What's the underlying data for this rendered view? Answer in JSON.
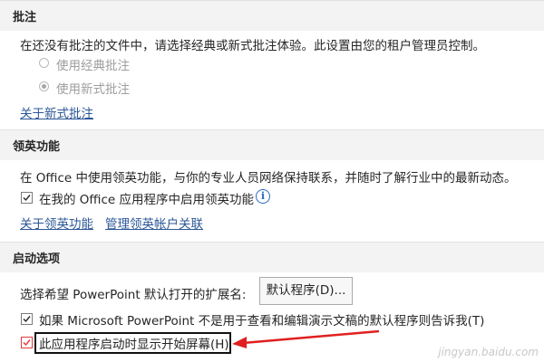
{
  "annotations": {
    "sec1": {
      "title": "批注",
      "desc": "在还没有批注的文件中，请选择经典或新式批注体验。此设置由您的租户管理员控制。",
      "opt_classic": "使用经典批注",
      "opt_modern": "使用新式批注",
      "selected": "opt_modern",
      "link": "关于新式批注"
    },
    "sec2": {
      "title": "领英功能",
      "desc": "在 Office 中使用领英功能，与你的专业人员网络保持联系，并随时了解行业中的最新动态。",
      "enable_label": "在我的 Office 应用程序中启用领英功能",
      "enable_checked": true,
      "link_about": "关于领英功能",
      "link_manage": "管理领英帐户关联"
    },
    "sec3": {
      "title": "启动选项",
      "ext_label": "选择希望 PowerPoint 默认打开的扩展名:",
      "default_btn": "默认程序(D)...",
      "default_check_label": "如果 Microsoft PowerPoint 不是用于查看和编辑演示文稿的默认程序则告诉我(T)",
      "default_checked": true,
      "start_screen_label": "此应用程序启动时显示开始屏幕(H)",
      "start_screen_checked": true
    }
  },
  "colors": {
    "link": "#2b5797",
    "highlight_arrow": "#e02020"
  },
  "watermark": "jingyan.baidu.com"
}
